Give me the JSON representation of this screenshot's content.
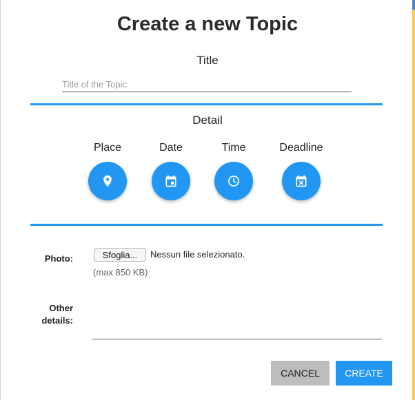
{
  "dialog": {
    "title": "Create a new Topic",
    "title_section": {
      "label": "Title",
      "placeholder": "Title of the Topic",
      "value": ""
    },
    "detail_section": {
      "label": "Detail",
      "items": [
        {
          "label": "Place",
          "icon": "map-pin-icon"
        },
        {
          "label": "Date",
          "icon": "calendar-icon"
        },
        {
          "label": "Time",
          "icon": "clock-icon"
        },
        {
          "label": "Deadline",
          "icon": "calendar-x-icon"
        }
      ]
    },
    "photo": {
      "label": "Photo:",
      "button_label": "Sfoglia...",
      "status": "Nessun file selezionato.",
      "hint": "(max 850 KB)"
    },
    "other_details": {
      "label_line1": "Other",
      "label_line2": "details:",
      "value": ""
    },
    "buttons": {
      "cancel": "CANCEL",
      "create": "CREATE"
    }
  },
  "colors": {
    "accent": "#2196f3",
    "cancel_bg": "#bdbdbd",
    "text": "#222222"
  }
}
